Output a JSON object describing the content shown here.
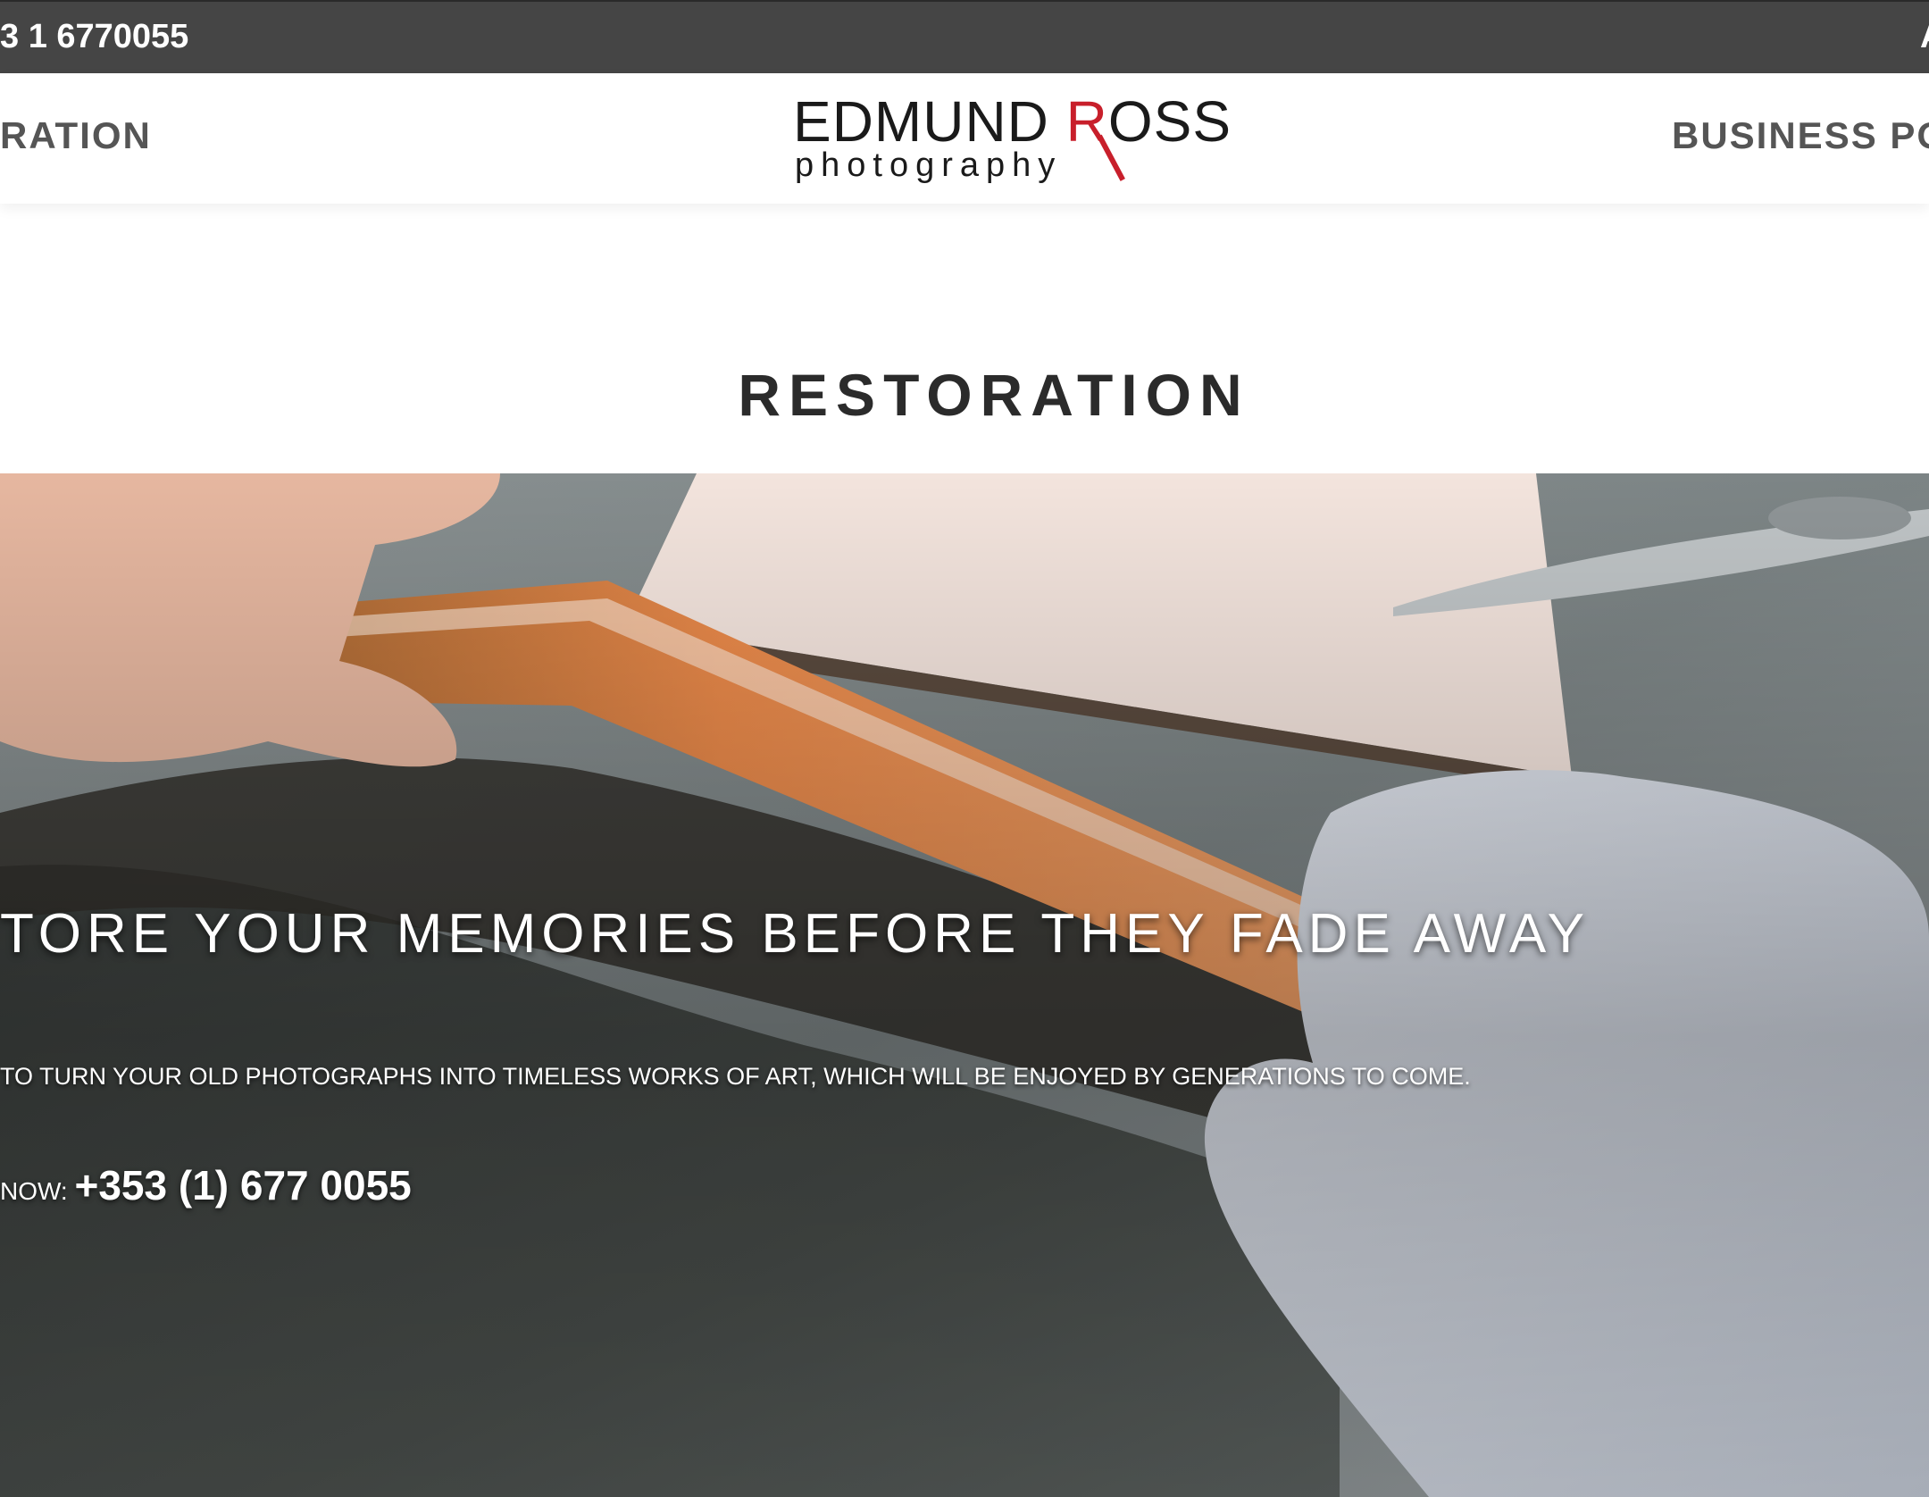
{
  "topbar": {
    "phone": "3 1 6770055",
    "right_text": "A"
  },
  "nav": {
    "left_item": "RATION",
    "right_item": "BUSINESS POR"
  },
  "logo": {
    "name_part1": "EDMUND ",
    "name_r": "R",
    "name_part2": "OSS",
    "tagline": "photography",
    "accent_color": "#c81f2b"
  },
  "page": {
    "title": "RESTORATION"
  },
  "hero": {
    "heading": "TORE YOUR MEMORIES BEFORE THEY FADE AWAY",
    "subtext": "TO TURN YOUR OLD PHOTOGRAPHS INTO TIMELESS WORKS OF ART, WHICH WILL BE ENJOYED BY GENERATIONS TO COME.",
    "call_label": "NOW: ",
    "call_number": "+353 (1) 677 0055"
  }
}
